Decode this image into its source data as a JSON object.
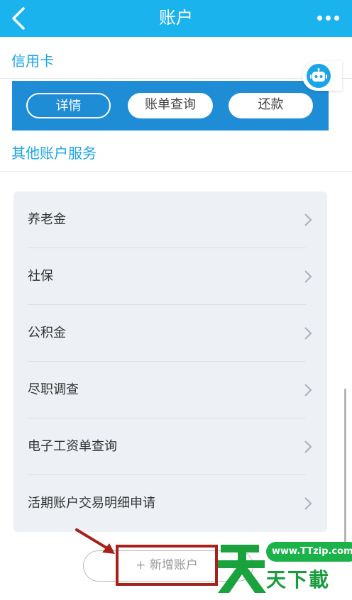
{
  "header": {
    "title": "账户",
    "back_icon": "chevron-left-icon",
    "more_icon": "more-dots-icon",
    "color": "#1ab3ee"
  },
  "credit_card": {
    "section_title": "信用卡",
    "buttons": {
      "detail": "详情",
      "bill_query": "账单查询",
      "repay": "还款"
    },
    "strip_color": "#1e8dd6"
  },
  "assistant": {
    "icon": "robot-icon"
  },
  "other_services": {
    "section_title": "其他账户服务",
    "items": [
      {
        "label": "养老金"
      },
      {
        "label": "社保"
      },
      {
        "label": "公积金"
      },
      {
        "label": "尽职调查"
      },
      {
        "label": "电子工资单查询"
      },
      {
        "label": "活期账户交易明细申请"
      }
    ]
  },
  "add_account": {
    "label": "+ 新增账户",
    "highlight_color": "#a8201a"
  },
  "watermark": {
    "url": "www.TTzip.com",
    "logo_char": "天",
    "text": "天下載"
  }
}
